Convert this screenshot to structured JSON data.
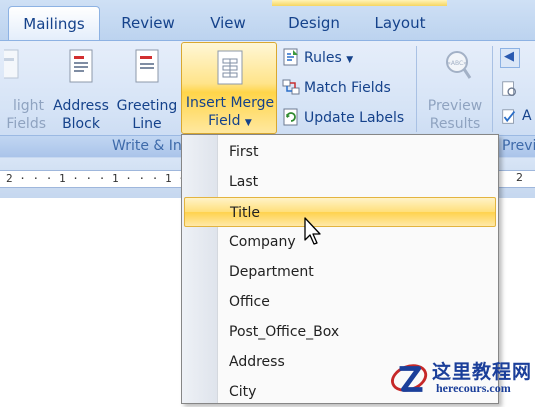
{
  "tabs": [
    {
      "label": "Mailings",
      "active": true
    },
    {
      "label": "Review",
      "active": false
    },
    {
      "label": "View",
      "active": false
    },
    {
      "label": "Design",
      "active": false
    },
    {
      "label": "Layout",
      "active": false
    }
  ],
  "ribbon": {
    "highlight_fields": {
      "line1": "light",
      "line2": "Fields"
    },
    "address_block": {
      "line1": "Address",
      "line2": "Block"
    },
    "greeting_line": {
      "line1": "Greeting",
      "line2": "Line"
    },
    "insert_merge_field": {
      "line1": "Insert Merge",
      "line2": "Field"
    },
    "rules": "Rules",
    "match_fields": "Match Fields",
    "update_labels": "Update Labels",
    "preview_results": {
      "line1": "Preview",
      "line2": "Results"
    },
    "group_write_insert": "Write & In",
    "group_preview": "Previ"
  },
  "ruler": {
    "text": "2 · · · 1 · · · 1 · · · 1 ·"
  },
  "ruler_right": "2",
  "menu": {
    "items": [
      "First",
      "Last",
      "Title",
      "Company",
      "Department",
      "Office",
      "Post_Office_Box",
      "Address",
      "City"
    ],
    "hover_index": 2
  },
  "watermark": {
    "cn": "这里教程网",
    "url": "herecours.com"
  },
  "colors": {
    "ribbon_text": "#15428b",
    "hover_gold": "#ffd24d",
    "tab_bar": "#bcd3ef"
  }
}
